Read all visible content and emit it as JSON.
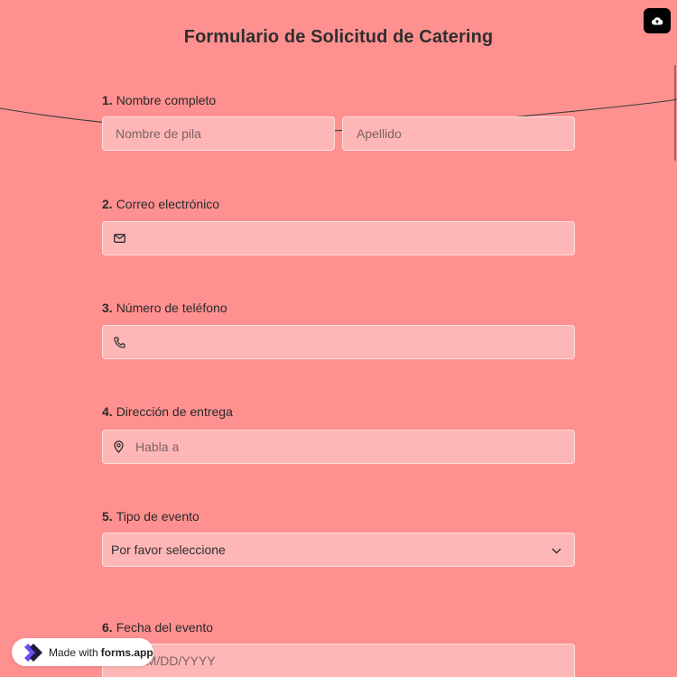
{
  "form": {
    "title": "Formulario de Solicitud de Catering",
    "questions": [
      {
        "number": "1.",
        "label": "Nombre completo",
        "first_placeholder": "Nombre de pila",
        "last_placeholder": "Apellido"
      },
      {
        "number": "2.",
        "label": "Correo electrónico",
        "icon": "mail-icon"
      },
      {
        "number": "3.",
        "label": "Número de teléfono",
        "icon": "phone-icon"
      },
      {
        "number": "4.",
        "label": "Dirección de entrega",
        "icon": "location-pin-icon",
        "placeholder": "Habla a"
      },
      {
        "number": "5.",
        "label": "Tipo de evento",
        "selected": "Por favor seleccione"
      },
      {
        "number": "6.",
        "label": "Fecha del evento",
        "icon": "calendar-icon",
        "placeholder": "MM/DD/YYYY"
      }
    ]
  },
  "badge": {
    "made_with": "Made with",
    "brand": "forms.app"
  },
  "colors": {
    "background": "#ff9090",
    "field": "#ffb6b6",
    "text": "#2f2f2f",
    "upload_button": "#000000"
  }
}
